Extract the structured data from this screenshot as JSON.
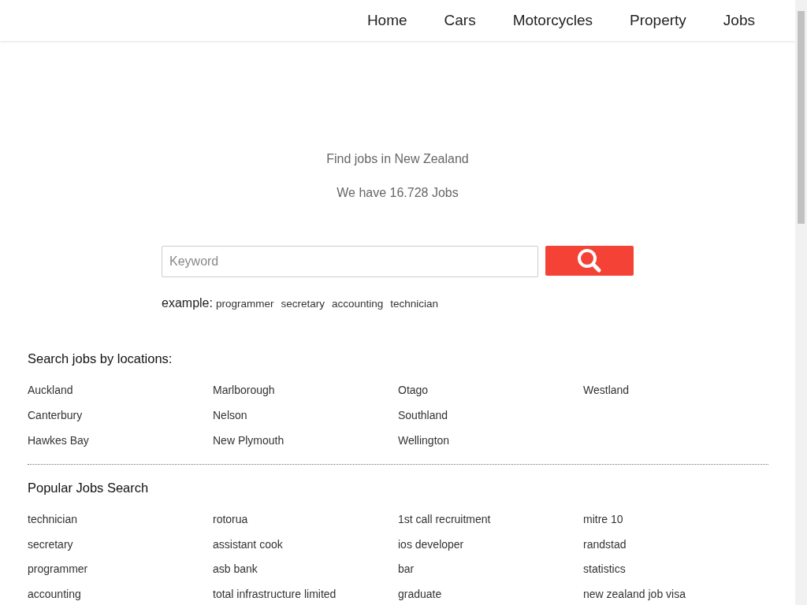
{
  "nav": [
    {
      "label": "Home"
    },
    {
      "label": "Cars"
    },
    {
      "label": "Motorcycles"
    },
    {
      "label": "Property"
    },
    {
      "label": "Jobs"
    }
  ],
  "hero": {
    "title": "Find jobs in New Zealand",
    "count": "We have 16.728 Jobs"
  },
  "search": {
    "placeholder": "Keyword"
  },
  "examples": {
    "label": "example:",
    "items": [
      "programmer",
      "secretary",
      "accounting",
      "technician"
    ]
  },
  "locations": {
    "heading": "Search jobs by locations:",
    "columns": [
      [
        "Auckland",
        "Canterbury",
        "Hawkes Bay"
      ],
      [
        "Marlborough",
        "Nelson",
        "New Plymouth"
      ],
      [
        "Otago",
        "Southland",
        "Wellington"
      ],
      [
        "Westland"
      ]
    ]
  },
  "popular": {
    "heading": "Popular Jobs Search",
    "columns": [
      [
        "technician",
        "secretary",
        "programmer",
        "accounting"
      ],
      [
        "rotorua",
        "assistant cook",
        "asb bank",
        "total infrastructure limited"
      ],
      [
        "1st call recruitment",
        "ios developer",
        "bar",
        "graduate"
      ],
      [
        "mitre 10",
        "randstad",
        "statistics",
        "new zealand job visa"
      ]
    ]
  }
}
